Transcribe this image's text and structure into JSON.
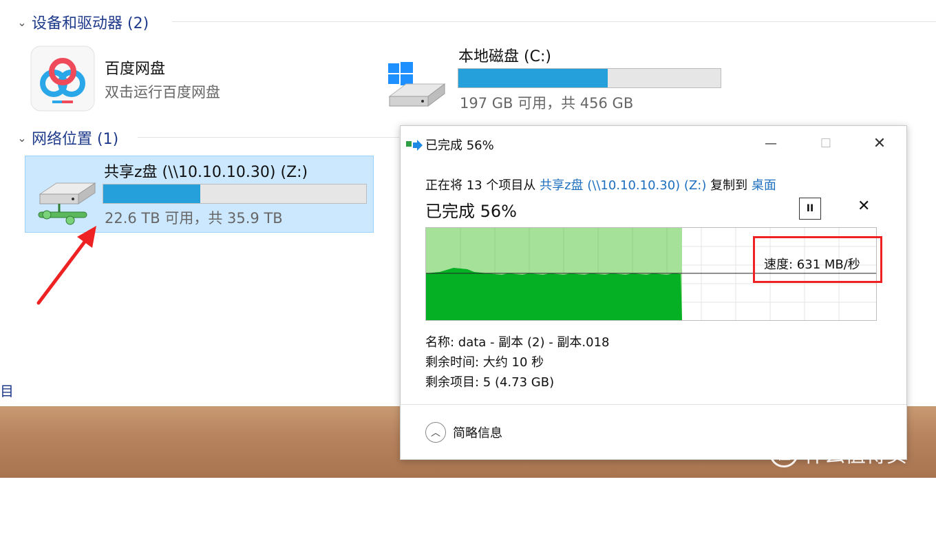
{
  "explorer": {
    "devices_header": "设备和驱动器 (2)",
    "network_header": "网络位置 (1)",
    "baidu": {
      "title": "百度网盘",
      "subtitle": "双击运行百度网盘"
    },
    "local_disk": {
      "title": "本地磁盘 (C:)",
      "usage": "197 GB 可用，共 456 GB",
      "used_fraction": 0.57
    },
    "share_drive": {
      "title": "共享z盘 (\\\\10.10.10.30) (Z:)",
      "usage": "22.6 TB 可用，共 35.9 TB",
      "used_fraction": 0.37
    },
    "left_edge_glyph": "目"
  },
  "dialog": {
    "title": "已完成 56%",
    "description_prefix": "正在将 13 个项目从 ",
    "source": "共享z盘 (\\\\10.10.10.30) (Z:)",
    "description_mid": " 复制到 ",
    "destination": "桌面",
    "percent_text": "已完成 56%",
    "progress_fraction": 0.56,
    "speed": "速度: 631 MB/秒",
    "name_line": "名称: data - 副本 (2) - 副本.018",
    "time_left": "剩余时间: 大约 10 秒",
    "items_left": "剩余项目: 5 (4.73 GB)",
    "less_details": "简略信息",
    "pause_glyph": "II",
    "close_glyph": "✕",
    "minimize_glyph": "—",
    "maximize_glyph": "☐",
    "window_close_glyph": "✕"
  },
  "watermark": {
    "text": "什么值得买",
    "logo_glyph": "值"
  },
  "colors": {
    "progress_blue": "#26a0da",
    "graph_green": "#06b025",
    "graph_light_green": "#a6e19a",
    "highlight_red": "#e22222"
  }
}
